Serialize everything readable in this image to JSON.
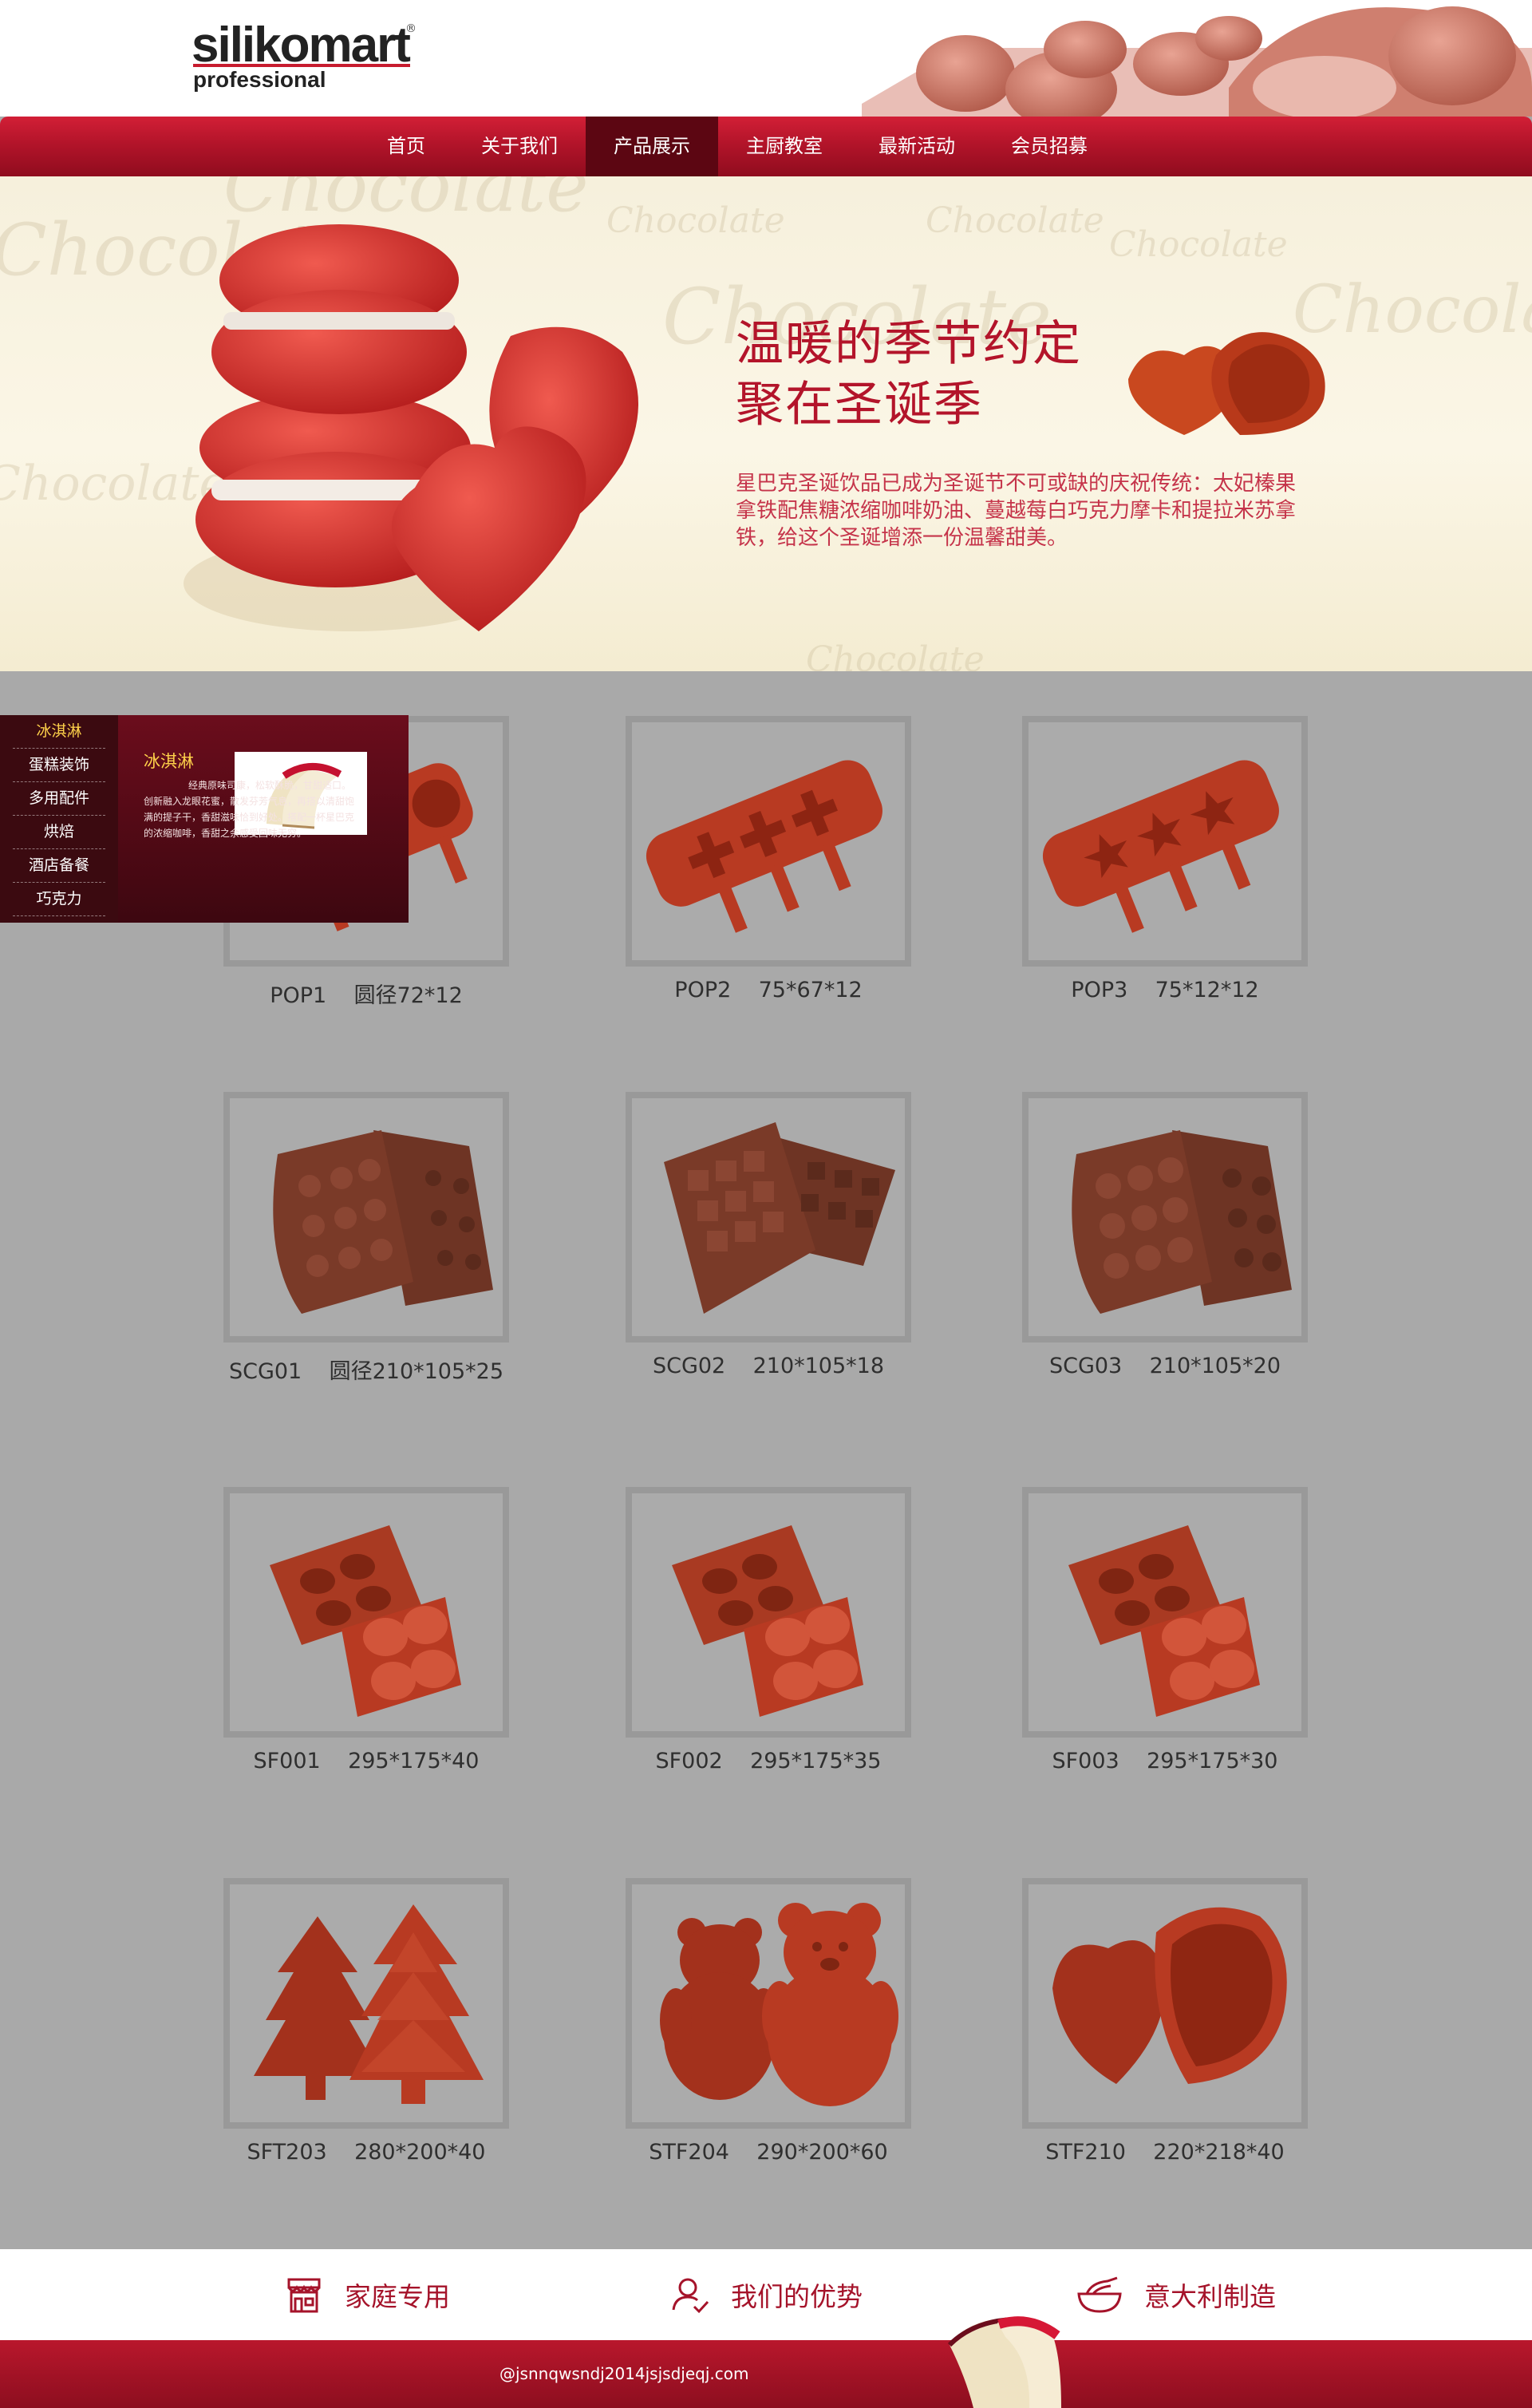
{
  "brand": {
    "logo_text": "silikomart",
    "logo_sub": "professional",
    "reg_mark": "®"
  },
  "nav": {
    "items": [
      {
        "label": "首页"
      },
      {
        "label": "关于我们"
      },
      {
        "label": "产品展示",
        "active": true
      },
      {
        "label": "主厨教室"
      },
      {
        "label": "最新活动"
      },
      {
        "label": "会员招募"
      }
    ]
  },
  "banner": {
    "background_word": "Chocolate",
    "title_line1": "温暖的季节约定",
    "title_line2": "聚在圣诞季",
    "text": "星巴克圣诞饮品已成为圣诞节不可或缺的庆祝传统：太妃榛果拿铁配焦糖浓缩咖啡奶油、蔓越莓白巧克力摩卡和提拉米苏拿铁，给这个圣诞增添一份温馨甜美。"
  },
  "side_menu": {
    "items": [
      "冰淇淋",
      "蛋糕装饰",
      "多用配件",
      "烘焙",
      "酒店备餐",
      "巧克力"
    ],
    "panel_title": "冰淇淋",
    "panel_text": "经典原味司康，松软酥脆，甘甜适口。创新融入龙眼花蜜，散发芬芳气息，再搭以清甜饱满的提子干，香甜滋味恰到好处。搭配一杯星巴克的浓缩咖啡，香甜之余感受回味无穷。"
  },
  "products": [
    {
      "code": "POP1",
      "size": "圆径72*12",
      "shape": "pop-round"
    },
    {
      "code": "POP2",
      "size": "75*67*12",
      "shape": "pop-cross"
    },
    {
      "code": "POP3",
      "size": "75*12*12",
      "shape": "pop-star"
    },
    {
      "code": "SCG01",
      "size": "圆径210*105*25",
      "shape": "choc-cone"
    },
    {
      "code": "SCG02",
      "size": "210*105*18",
      "shape": "choc-square"
    },
    {
      "code": "SCG03",
      "size": "210*105*20",
      "shape": "choc-round"
    },
    {
      "code": "SF001",
      "size": "295*175*40",
      "shape": "oval"
    },
    {
      "code": "SF002",
      "size": "295*175*35",
      "shape": "oval"
    },
    {
      "code": "SF003",
      "size": "295*175*30",
      "shape": "oval"
    },
    {
      "code": "SFT203",
      "size": "280*200*40",
      "shape": "tree"
    },
    {
      "code": "STF204",
      "size": "290*200*60",
      "shape": "bear"
    },
    {
      "code": "STF210",
      "size": "220*218*40",
      "shape": "heart"
    }
  ],
  "features": [
    {
      "label": "家庭专用",
      "icon": "shop-icon"
    },
    {
      "label": "我们的优势",
      "icon": "user-check-icon"
    },
    {
      "label": "意大利制造",
      "icon": "bowl-icon"
    }
  ],
  "footer": {
    "copyright": "@jsnnqwsndj2014jsjsdjeqj.com"
  },
  "colors": {
    "brand_red": "#b3142a",
    "nav_active": "#5c0612",
    "mold_red": "#b83a22",
    "chocolate": "#7a3a28"
  }
}
